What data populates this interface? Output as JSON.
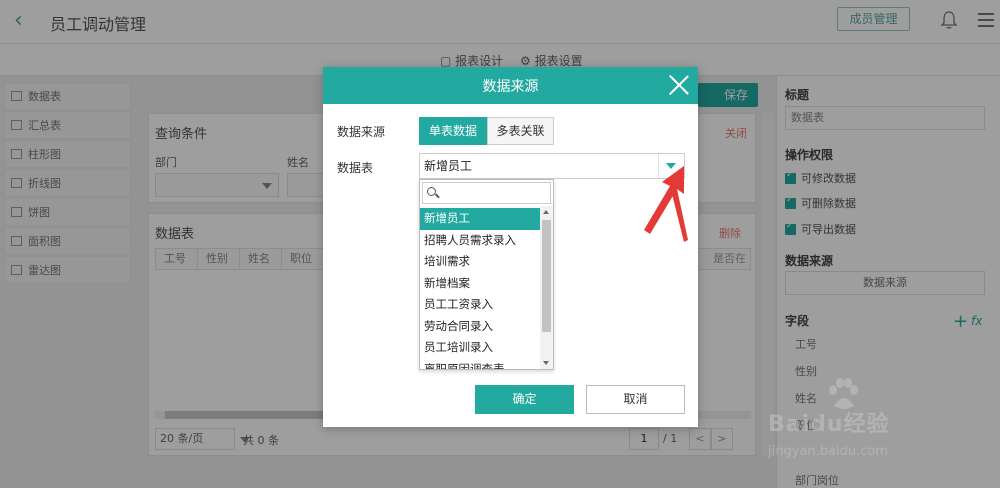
{
  "app": {
    "title": "员工调动管理",
    "member_button": "成员管理"
  },
  "subbar": {
    "design_tab": "报表设计",
    "settings_tab": "报表设置"
  },
  "left_nav": {
    "items": [
      "数据表",
      "汇总表",
      "柱形图",
      "折线图",
      "饼图",
      "面积图",
      "雷达图"
    ]
  },
  "toolbar": {
    "save_label": "保存"
  },
  "query": {
    "title": "查询条件",
    "close_link": "关闭",
    "dept_label": "部门",
    "name_label": "姓名"
  },
  "table": {
    "title": "数据表",
    "delete_link": "删除",
    "columns": [
      "工号",
      "性别",
      "姓名",
      "职位"
    ],
    "last_column": "是否在",
    "page_size": "20 条/页",
    "total": "共 0 条",
    "page_current": "1",
    "page_total": "/ 1",
    "prev": "<",
    "next": ">"
  },
  "right_panel": {
    "title_heading": "标题",
    "title_value": "数据表",
    "perm_heading": "操作权限",
    "perm_items": [
      "可修改数据",
      "可删除数据",
      "可导出数据"
    ],
    "source_heading": "数据来源",
    "source_button": "数据来源",
    "field_heading": "字段",
    "fx": "fx",
    "fields": [
      "工号",
      "性别",
      "姓名",
      "职位",
      "部门岗位"
    ]
  },
  "modal": {
    "title": "数据来源",
    "source_label": "数据来源",
    "single_table": "单表数据",
    "multi_table": "多表关联",
    "table_label": "数据表",
    "selected_table": "新增员工",
    "search_placeholder": "",
    "options": [
      "新增员工",
      "招聘人员需求录入",
      "培训需求",
      "新增档案",
      "员工工资录入",
      "劳动合同录入",
      "员工培训录入",
      "离职原因调查表"
    ],
    "ok": "确定",
    "cancel": "取消"
  },
  "watermark": {
    "text": "Baidu经验",
    "url": "jingyan.baidu.com"
  },
  "colors": {
    "accent": "#23aaa0",
    "annotation": "#e53935"
  }
}
